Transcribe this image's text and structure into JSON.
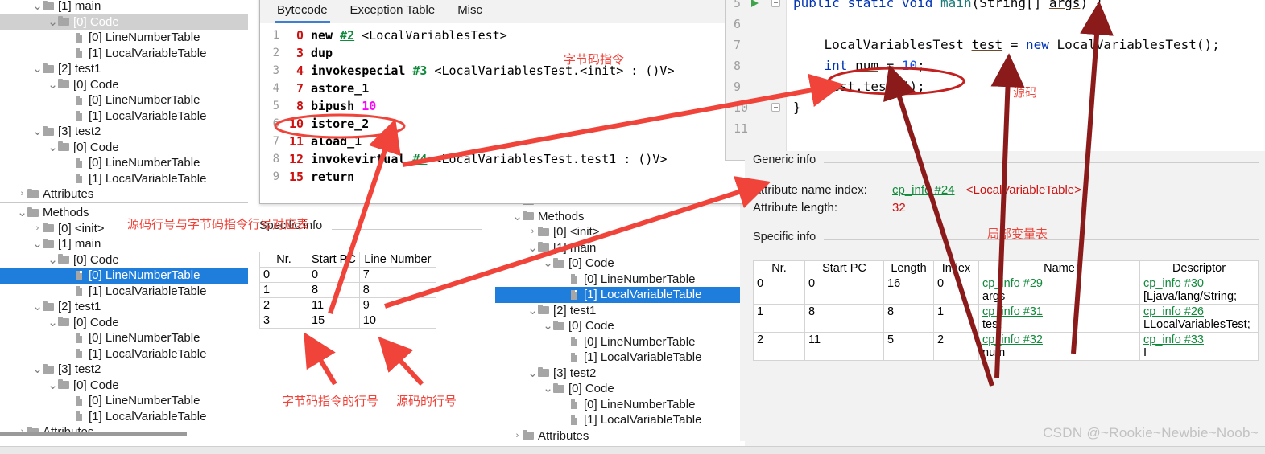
{
  "left_tree_top": {
    "items": [
      {
        "indent": 2,
        "arrow": "v",
        "icon": "folder",
        "label": "[1] main",
        "state": "none"
      },
      {
        "indent": 3,
        "arrow": "v",
        "icon": "folder",
        "label": "[0] Code",
        "state": "sel-gray"
      },
      {
        "indent": 4,
        "arrow": "",
        "icon": "file",
        "label": "[0] LineNumberTable",
        "state": "none"
      },
      {
        "indent": 4,
        "arrow": "",
        "icon": "file",
        "label": "[1] LocalVariableTable",
        "state": "none"
      },
      {
        "indent": 2,
        "arrow": "v",
        "icon": "folder",
        "label": "[2] test1",
        "state": "none"
      },
      {
        "indent": 3,
        "arrow": "v",
        "icon": "folder",
        "label": "[0] Code",
        "state": "none"
      },
      {
        "indent": 4,
        "arrow": "",
        "icon": "file",
        "label": "[0] LineNumberTable",
        "state": "none"
      },
      {
        "indent": 4,
        "arrow": "",
        "icon": "file",
        "label": "[1] LocalVariableTable",
        "state": "none"
      },
      {
        "indent": 2,
        "arrow": "v",
        "icon": "folder",
        "label": "[3] test2",
        "state": "none"
      },
      {
        "indent": 3,
        "arrow": "v",
        "icon": "folder",
        "label": "[0] Code",
        "state": "none"
      },
      {
        "indent": 4,
        "arrow": "",
        "icon": "file",
        "label": "[0] LineNumberTable",
        "state": "none"
      },
      {
        "indent": 4,
        "arrow": "",
        "icon": "file",
        "label": "[1] LocalVariableTable",
        "state": "none"
      },
      {
        "indent": 1,
        "arrow": ">",
        "icon": "folder",
        "label": "Attributes",
        "state": "none"
      }
    ]
  },
  "left_tree_bottom": {
    "items": [
      {
        "indent": 1,
        "arrow": "v",
        "icon": "folder",
        "label": "Methods",
        "state": "none"
      },
      {
        "indent": 2,
        "arrow": ">",
        "icon": "folder",
        "label": "[0] <init>",
        "state": "none"
      },
      {
        "indent": 2,
        "arrow": "v",
        "icon": "folder",
        "label": "[1] main",
        "state": "none"
      },
      {
        "indent": 3,
        "arrow": "v",
        "icon": "folder",
        "label": "[0] Code",
        "state": "none"
      },
      {
        "indent": 4,
        "arrow": "",
        "icon": "file",
        "label": "[0] LineNumberTable",
        "state": "sel-blue"
      },
      {
        "indent": 4,
        "arrow": "",
        "icon": "file",
        "label": "[1] LocalVariableTable",
        "state": "none"
      },
      {
        "indent": 2,
        "arrow": "v",
        "icon": "folder",
        "label": "[2] test1",
        "state": "none"
      },
      {
        "indent": 3,
        "arrow": "v",
        "icon": "folder",
        "label": "[0] Code",
        "state": "none"
      },
      {
        "indent": 4,
        "arrow": "",
        "icon": "file",
        "label": "[0] LineNumberTable",
        "state": "none"
      },
      {
        "indent": 4,
        "arrow": "",
        "icon": "file",
        "label": "[1] LocalVariableTable",
        "state": "none"
      },
      {
        "indent": 2,
        "arrow": "v",
        "icon": "folder",
        "label": "[3] test2",
        "state": "none"
      },
      {
        "indent": 3,
        "arrow": "v",
        "icon": "folder",
        "label": "[0] Code",
        "state": "none"
      },
      {
        "indent": 4,
        "arrow": "",
        "icon": "file",
        "label": "[0] LineNumberTable",
        "state": "none"
      },
      {
        "indent": 4,
        "arrow": "",
        "icon": "file",
        "label": "[1] LocalVariableTable",
        "state": "none"
      },
      {
        "indent": 1,
        "arrow": ">",
        "icon": "folder",
        "label": "Attributes",
        "state": "none"
      }
    ]
  },
  "mid_tree": {
    "items": [
      {
        "indent": 1,
        "arrow": "v",
        "icon": "folder",
        "label": "Fields",
        "state": "none"
      },
      {
        "indent": 1,
        "arrow": "v",
        "icon": "folder",
        "label": "Methods",
        "state": "none"
      },
      {
        "indent": 2,
        "arrow": ">",
        "icon": "folder",
        "label": "[0] <init>",
        "state": "none"
      },
      {
        "indent": 2,
        "arrow": "v",
        "icon": "folder",
        "label": "[1] main",
        "state": "none"
      },
      {
        "indent": 3,
        "arrow": "v",
        "icon": "folder",
        "label": "[0] Code",
        "state": "none"
      },
      {
        "indent": 4,
        "arrow": "",
        "icon": "file",
        "label": "[0] LineNumberTable",
        "state": "none"
      },
      {
        "indent": 4,
        "arrow": "",
        "icon": "file",
        "label": "[1] LocalVariableTable",
        "state": "sel-blue"
      },
      {
        "indent": 2,
        "arrow": "v",
        "icon": "folder",
        "label": "[2] test1",
        "state": "none"
      },
      {
        "indent": 3,
        "arrow": "v",
        "icon": "folder",
        "label": "[0] Code",
        "state": "none"
      },
      {
        "indent": 4,
        "arrow": "",
        "icon": "file",
        "label": "[0] LineNumberTable",
        "state": "none"
      },
      {
        "indent": 4,
        "arrow": "",
        "icon": "file",
        "label": "[1] LocalVariableTable",
        "state": "none"
      },
      {
        "indent": 2,
        "arrow": "v",
        "icon": "folder",
        "label": "[3] test2",
        "state": "none"
      },
      {
        "indent": 3,
        "arrow": "v",
        "icon": "folder",
        "label": "[0] Code",
        "state": "none"
      },
      {
        "indent": 4,
        "arrow": "",
        "icon": "file",
        "label": "[0] LineNumberTable",
        "state": "none"
      },
      {
        "indent": 4,
        "arrow": "",
        "icon": "file",
        "label": "[1] LocalVariableTable",
        "state": "none"
      },
      {
        "indent": 1,
        "arrow": ">",
        "icon": "folder",
        "label": "Attributes",
        "state": "none"
      }
    ]
  },
  "bytecode_window": {
    "group_title": "Specific info",
    "tabs": [
      {
        "label": "Bytecode",
        "active": true
      },
      {
        "label": "Exception Table",
        "active": false
      },
      {
        "label": "Misc",
        "active": false
      }
    ],
    "lines": [
      {
        "ln": "1",
        "off": "0",
        "op": "new",
        "ref": "#2",
        "arg": "",
        "desc": "<LocalVariablesTest>"
      },
      {
        "ln": "2",
        "off": "3",
        "op": "dup",
        "ref": "",
        "arg": "",
        "desc": ""
      },
      {
        "ln": "3",
        "off": "4",
        "op": "invokespecial",
        "ref": "#3",
        "arg": "",
        "desc": "<LocalVariablesTest.<init> : ()V>"
      },
      {
        "ln": "4",
        "off": "7",
        "op": "astore_1",
        "ref": "",
        "arg": "",
        "desc": ""
      },
      {
        "ln": "5",
        "off": "8",
        "op": "bipush",
        "ref": "",
        "arg": "10",
        "desc": ""
      },
      {
        "ln": "6",
        "off": "10",
        "op": "istore_2",
        "ref": "",
        "arg": "",
        "desc": ""
      },
      {
        "ln": "7",
        "off": "11",
        "op": "aload_1",
        "ref": "",
        "arg": "",
        "desc": ""
      },
      {
        "ln": "8",
        "off": "12",
        "op": "invokevirtual",
        "ref": "#4",
        "arg": "",
        "desc": "<LocalVariablesTest.test1 : ()V>"
      },
      {
        "ln": "9",
        "off": "15",
        "op": "return",
        "ref": "",
        "arg": "",
        "desc": ""
      }
    ]
  },
  "line_number_table": {
    "group_title": "Specific info",
    "headers": [
      "Nr.",
      "Start PC",
      "Line Number"
    ],
    "rows": [
      [
        "0",
        "0",
        "7"
      ],
      [
        "1",
        "8",
        "8"
      ],
      [
        "2",
        "11",
        "9"
      ],
      [
        "3",
        "15",
        "10"
      ]
    ]
  },
  "code_editor": {
    "gutter": [
      "5",
      "6",
      "7",
      "8",
      "9",
      "10",
      "11"
    ],
    "lines": [
      [
        {
          "t": "public",
          "c": "kw"
        },
        {
          "t": " ",
          "c": "plain"
        },
        {
          "t": "static",
          "c": "kw"
        },
        {
          "t": " ",
          "c": "plain"
        },
        {
          "t": "void",
          "c": "kw"
        },
        {
          "t": " ",
          "c": "plain"
        },
        {
          "t": "main",
          "c": "cls"
        },
        {
          "t": "(String[] ",
          "c": "plain"
        },
        {
          "t": "args",
          "c": "und"
        },
        {
          "t": ") {",
          "c": "plain"
        }
      ],
      [],
      [
        {
          "t": "    LocalVariablesTest ",
          "c": "plain"
        },
        {
          "t": "test",
          "c": "und"
        },
        {
          "t": " = ",
          "c": "plain"
        },
        {
          "t": "new",
          "c": "kw"
        },
        {
          "t": " LocalVariablesTest();",
          "c": "plain"
        }
      ],
      [
        {
          "t": "    ",
          "c": "plain"
        },
        {
          "t": "int",
          "c": "kw"
        },
        {
          "t": " ",
          "c": "plain"
        },
        {
          "t": "num",
          "c": "und"
        },
        {
          "t": " = ",
          "c": "plain"
        },
        {
          "t": "10",
          "c": "num"
        },
        {
          "t": ";",
          "c": "plain"
        }
      ],
      [
        {
          "t": "    test.test1();",
          "c": "plain"
        }
      ],
      [
        {
          "t": "}",
          "c": "plain"
        }
      ],
      []
    ]
  },
  "right_panel": {
    "generic_title": "Generic info",
    "attribute_name_index_label": "Attribute name index:",
    "attribute_name_index_value": "cp_info #24",
    "attribute_name_index_desc": "<LocalVariableTable>",
    "attribute_length_label": "Attribute length:",
    "attribute_length_value": "32",
    "specific_title": "Specific info",
    "table": {
      "headers": [
        "Nr.",
        "Start PC",
        "Length",
        "Index",
        "Name",
        "Descriptor"
      ],
      "rows": [
        {
          "nr": "0",
          "start_pc": "0",
          "length": "16",
          "index": "0",
          "name_ref": "cp_info #29",
          "name_val": "args",
          "desc_ref": "cp_info #30",
          "desc_val": "[Ljava/lang/String;"
        },
        {
          "nr": "1",
          "start_pc": "8",
          "length": "8",
          "index": "1",
          "name_ref": "cp_info #31",
          "name_val": "test",
          "desc_ref": "cp_info #26",
          "desc_val": "LLocalVariablesTest;"
        },
        {
          "nr": "2",
          "start_pc": "11",
          "length": "5",
          "index": "2",
          "name_ref": "cp_info #32",
          "name_val": "num",
          "desc_ref": "cp_info #33",
          "desc_val": "I"
        }
      ]
    }
  },
  "annotations": {
    "bytecode_instruction": "字节码指令",
    "line_mapping_table": "源码行号与字节码指令行号对应表",
    "bytecode_line_no": "字节码指令的行号",
    "source_line_no": "源码的行号",
    "source_code": "源码",
    "local_variable_table": "局部变量表"
  },
  "watermark": "CSDN @~Rookie~Newbie~Noob~",
  "colors": {
    "selection_blue": "#1f7ddb",
    "selection_gray": "#d0d0d0",
    "annotation_red": "#f0433a",
    "annotation_dark_red": "#8b1a1a",
    "offset_red": "#cc1111",
    "ref_green": "#118a3c",
    "arg_magenta": "#ff00ff",
    "keyword_blue": "#0033b3"
  }
}
